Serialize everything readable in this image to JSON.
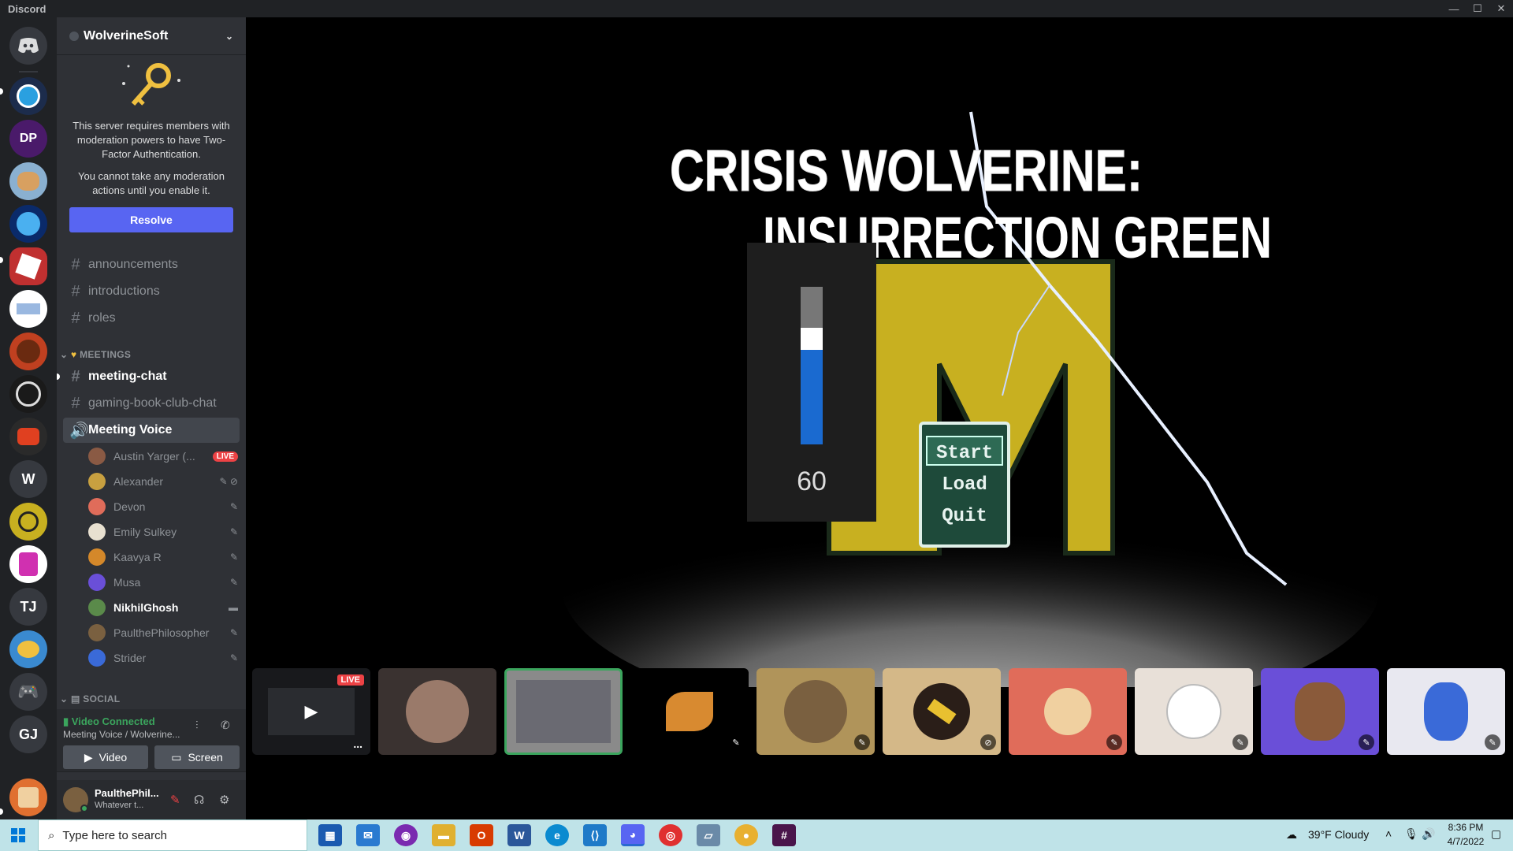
{
  "window": {
    "title": "Discord",
    "controls": [
      "—",
      "☐",
      "✕"
    ]
  },
  "guilds": {
    "items": [
      "W",
      "TJ",
      "GJ"
    ],
    "dp_label": "DP"
  },
  "server": {
    "name": "WolverineSoft",
    "header_chevron": "⌄"
  },
  "tfa": {
    "line1": "This server requires members with moderation powers to have Two-Factor Authentication.",
    "line2": "You cannot take any moderation actions until you enable it.",
    "resolve": "Resolve"
  },
  "channels": {
    "top": [
      "announcements",
      "introductions",
      "roles"
    ],
    "meetings_category": "MEETINGS",
    "meetings": [
      "meeting-chat",
      "gaming-book-club-chat"
    ],
    "voice": "Meeting Voice",
    "social_category": "SOCIAL"
  },
  "voice_users": [
    {
      "name": "Austin Yarger (...",
      "badge": "LIVE",
      "color": "#8a5a44"
    },
    {
      "name": "Alexander",
      "color": "#c8a040"
    },
    {
      "name": "Devon",
      "color": "#e06c5a"
    },
    {
      "name": "Emily Sulkey",
      "color": "#e8e0d0"
    },
    {
      "name": "Kaavya R",
      "color": "#d4882a"
    },
    {
      "name": "Musa",
      "color": "#6a4fd8"
    },
    {
      "name": "NikhilGhosh",
      "color": "#5a8a4a"
    },
    {
      "name": "PaulthePhilosopher",
      "color": "#7a6040"
    },
    {
      "name": "Strider",
      "color": "#3a6ad8"
    }
  ],
  "voice_connection": {
    "status": "Video Connected",
    "channel": "Meeting Voice / Wolverine...",
    "video": "Video",
    "screen": "Screen"
  },
  "user": {
    "name": "PaulthePhil...",
    "status": "Whatever t..."
  },
  "game": {
    "title1": "CRISIS WOLVERINE:",
    "title2": "INSURRECTION GREEN",
    "menu": [
      "Start",
      "Load",
      "Quit"
    ],
    "meter_value": "60",
    "meter_fill_fraction": 0.6
  },
  "tiles": {
    "live": "LIVE",
    "dots": "..."
  },
  "taskbar": {
    "search_placeholder": "Type here to search",
    "weather": "39°F  Cloudy",
    "time": "8:36 PM",
    "date": "4/7/2022"
  }
}
